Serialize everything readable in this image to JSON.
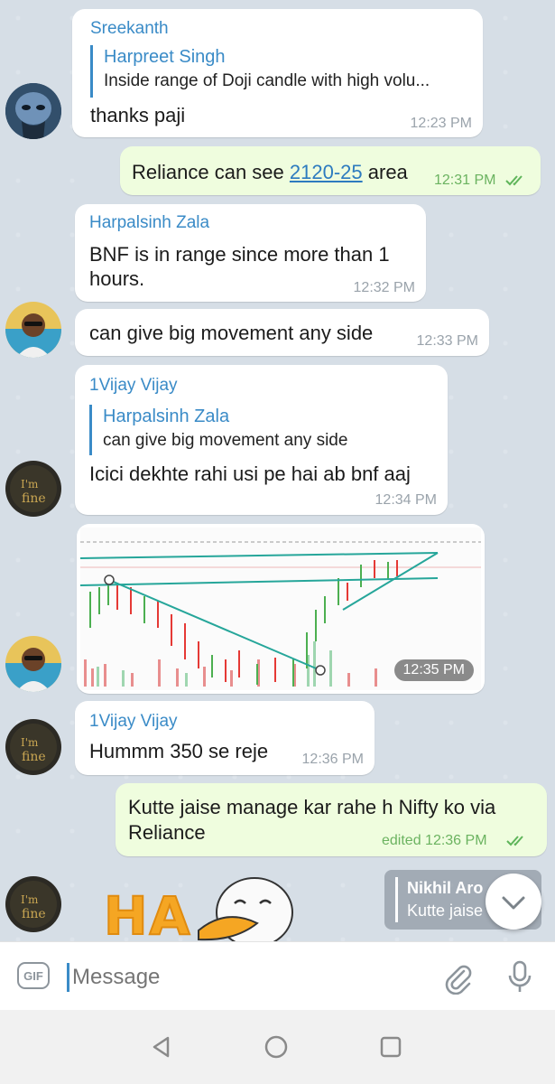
{
  "messages": {
    "m1": {
      "sender": "Sreekanth",
      "reply_name": "Harpreet Singh",
      "reply_text": "Inside range of Doji candle with high volu...",
      "text": "thanks paji",
      "time": "12:23 PM"
    },
    "m2": {
      "text_before": "Reliance can see ",
      "link": "2120-25",
      "text_after": " area",
      "time": "12:31 PM"
    },
    "m3": {
      "sender": "Harpalsinh Zala",
      "line1": "BNF is in range since more than 1",
      "line2": "hours.",
      "time": "12:32 PM"
    },
    "m4": {
      "text": "can give big movement any side",
      "time": "12:33 PM"
    },
    "m5": {
      "sender": "1Vijay Vijay",
      "reply_name": "Harpalsinh Zala",
      "reply_text": "can give big movement any side",
      "text": "Icici dekhte rahi usi pe hai ab bnf aaj",
      "time": "12:34 PM"
    },
    "m6": {
      "time": "12:35 PM"
    },
    "m7": {
      "sender": "1Vijay Vijay",
      "text": "Hummm 350 se reje",
      "time": "12:36 PM"
    },
    "m8": {
      "line1": "Kutte jaise manage kar rahe h Nifty ko via",
      "line2": "Reliance",
      "time": "edited 12:36 PM"
    },
    "m9": {
      "reply_name": "Nikhil Aro",
      "reply_text": "Kutte jaise",
      "sticker_text": "HA"
    }
  },
  "input": {
    "placeholder": "Message",
    "gif_label": "GIF"
  },
  "icons": {
    "attach": "paperclip-icon",
    "mic": "microphone-icon",
    "scroll_down": "chevron-down-icon",
    "nav_back": "back-triangle-icon",
    "nav_home": "home-circle-icon",
    "nav_recents": "recents-square-icon"
  },
  "colors": {
    "sender": "#3a8bc7",
    "outgoing_bubble": "#effdde",
    "check": "#5fb55a"
  }
}
